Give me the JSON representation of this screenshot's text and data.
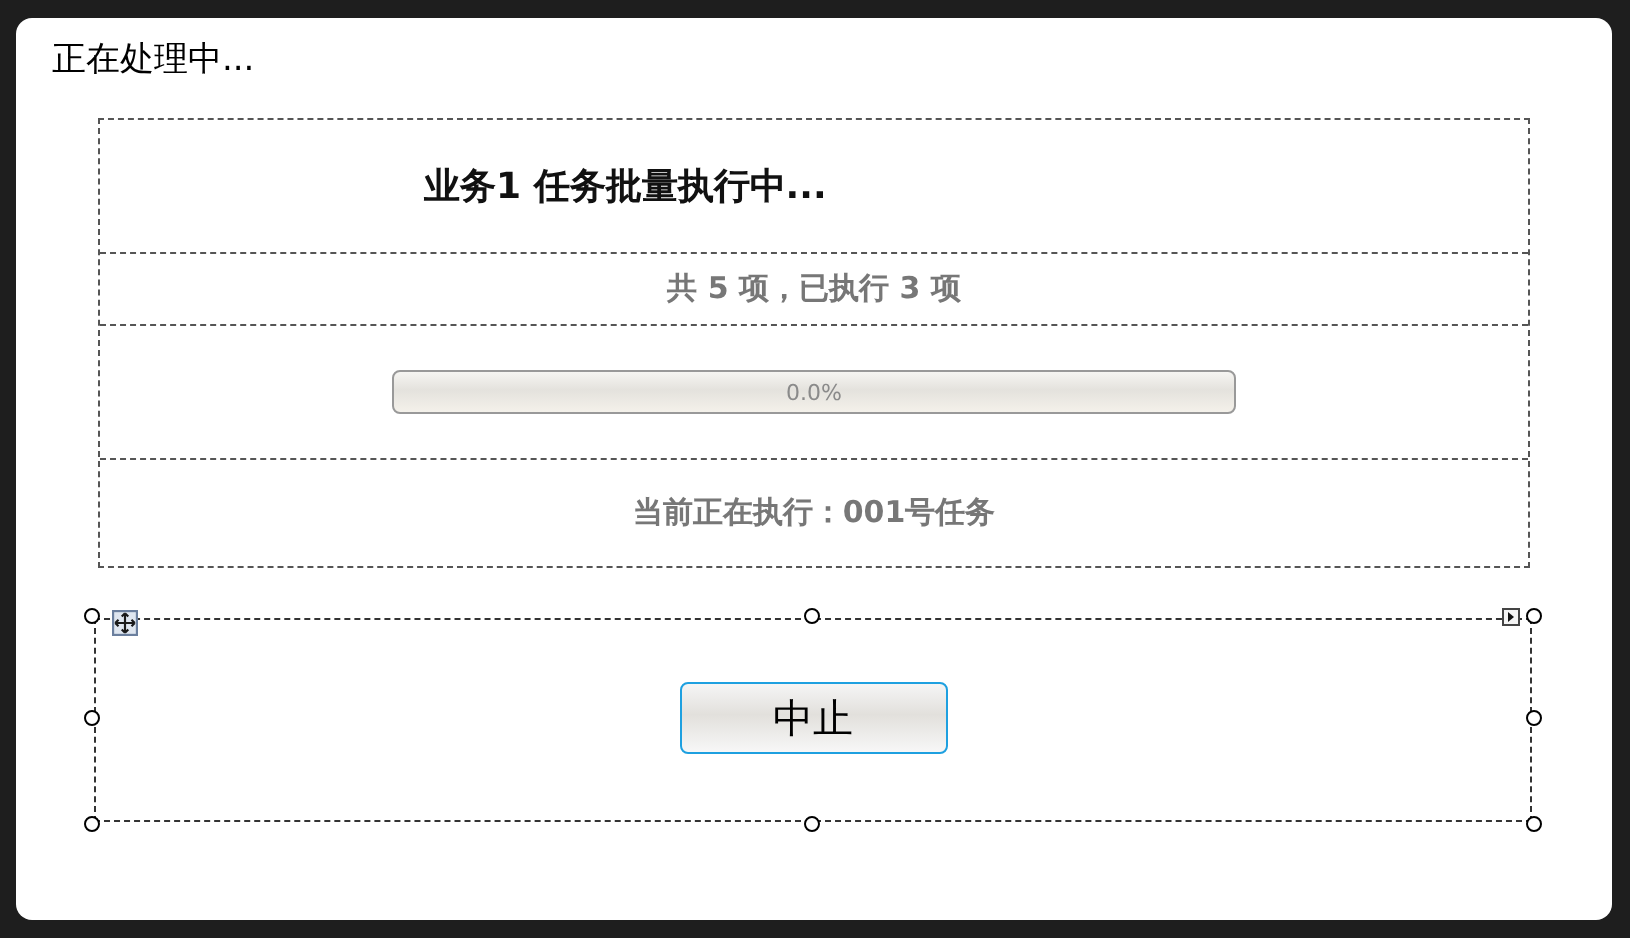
{
  "window": {
    "title": "正在处理中..."
  },
  "progress_table": {
    "heading": "业务1 任务批量执行中...",
    "summary": "共 5 项，已执行 3 项",
    "progress": {
      "level": 0,
      "reading": "0.0%"
    },
    "current": "当前正在执行：001号任务"
  },
  "button_panel": {
    "selected": true,
    "buttons": [
      {
        "label": "中止"
      }
    ]
  }
}
